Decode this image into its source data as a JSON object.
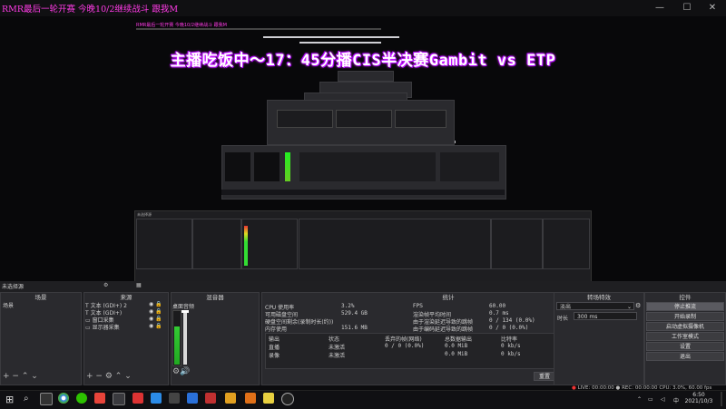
{
  "window": {
    "title": "RMR最后一轮开赛 今晚10/2继续战斗 跟我M",
    "minimize": "—",
    "maximize": "☐",
    "close": "✕"
  },
  "preview": {
    "overlay_text": "主播吃饭中～17：45分播CIS半决赛Gambit vs ETP",
    "mini_title": "RMR最后一轮开赛 今晚10/2继续战斗 跟我M"
  },
  "scene_bar": {
    "label": "未选择源"
  },
  "panels": {
    "scenes": {
      "header": "场景",
      "items": [
        "场景"
      ]
    },
    "sources": {
      "header": "来源",
      "items": [
        "文本 (GDI+) 2",
        "文本 (GDI+)",
        "窗口采集",
        "显示器采集"
      ]
    },
    "mixer": {
      "header": "混音器",
      "channel": "桌面音频"
    },
    "stats": {
      "header": "统计",
      "rows_left": [
        {
          "label": "CPU 使用率",
          "value": "3.2%"
        },
        {
          "label": "可用磁盘空间",
          "value": "529.4 GB"
        },
        {
          "label": "硬盘空间剩余(录制时长(约))",
          "value": ""
        },
        {
          "label": "内存使用",
          "value": "151.6 MB"
        }
      ],
      "rows_right": [
        {
          "label": "FPS",
          "value": "60.00"
        },
        {
          "label": "渲染帧平均时间",
          "value": "0.7 ms"
        },
        {
          "label": "由于渲染延迟导致的跳帧",
          "value": "0 / 134 (0.0%)"
        },
        {
          "label": "由于编码延迟导致的跳帧",
          "value": "0 / 0 (0.0%)"
        }
      ],
      "table_headers": [
        "输出",
        "状态",
        "丢弃的帧(网络)",
        "总数据输出",
        "比特率"
      ],
      "table_rows": [
        [
          "直播",
          "未激活",
          "0 / 0 (0.0%)",
          "0.0 MiB",
          "0 kb/s"
        ],
        [
          "录像",
          "未激活",
          "",
          "0.0 MiB",
          "0 kb/s"
        ]
      ],
      "reset_button": "重置"
    },
    "transitions": {
      "header": "转场特效",
      "transition": "淡出",
      "duration_label": "时长",
      "duration_value": "300 ms"
    },
    "controls": {
      "header": "控件",
      "buttons": [
        "停止推流",
        "开始录制",
        "启动虚拟摄像机",
        "工作室模式",
        "设置",
        "退出"
      ]
    }
  },
  "status_bar": {
    "live": "LIVE: 00:00:00",
    "rec": "REC: 00:00:00",
    "cpu": "CPU: 3.0%, 60.00 fps"
  },
  "taskbar": {
    "time": "6:50",
    "date": "2021/10/3",
    "tray_icons": [
      "chevron-up-icon",
      "network-icon",
      "volume-icon",
      "ime-icon"
    ]
  },
  "colors": {
    "overlay_glow": "#d020ff",
    "title_text": "#ff3be6",
    "obs_bg": "#1f1f22",
    "panel_bg": "#2a2a2e"
  }
}
